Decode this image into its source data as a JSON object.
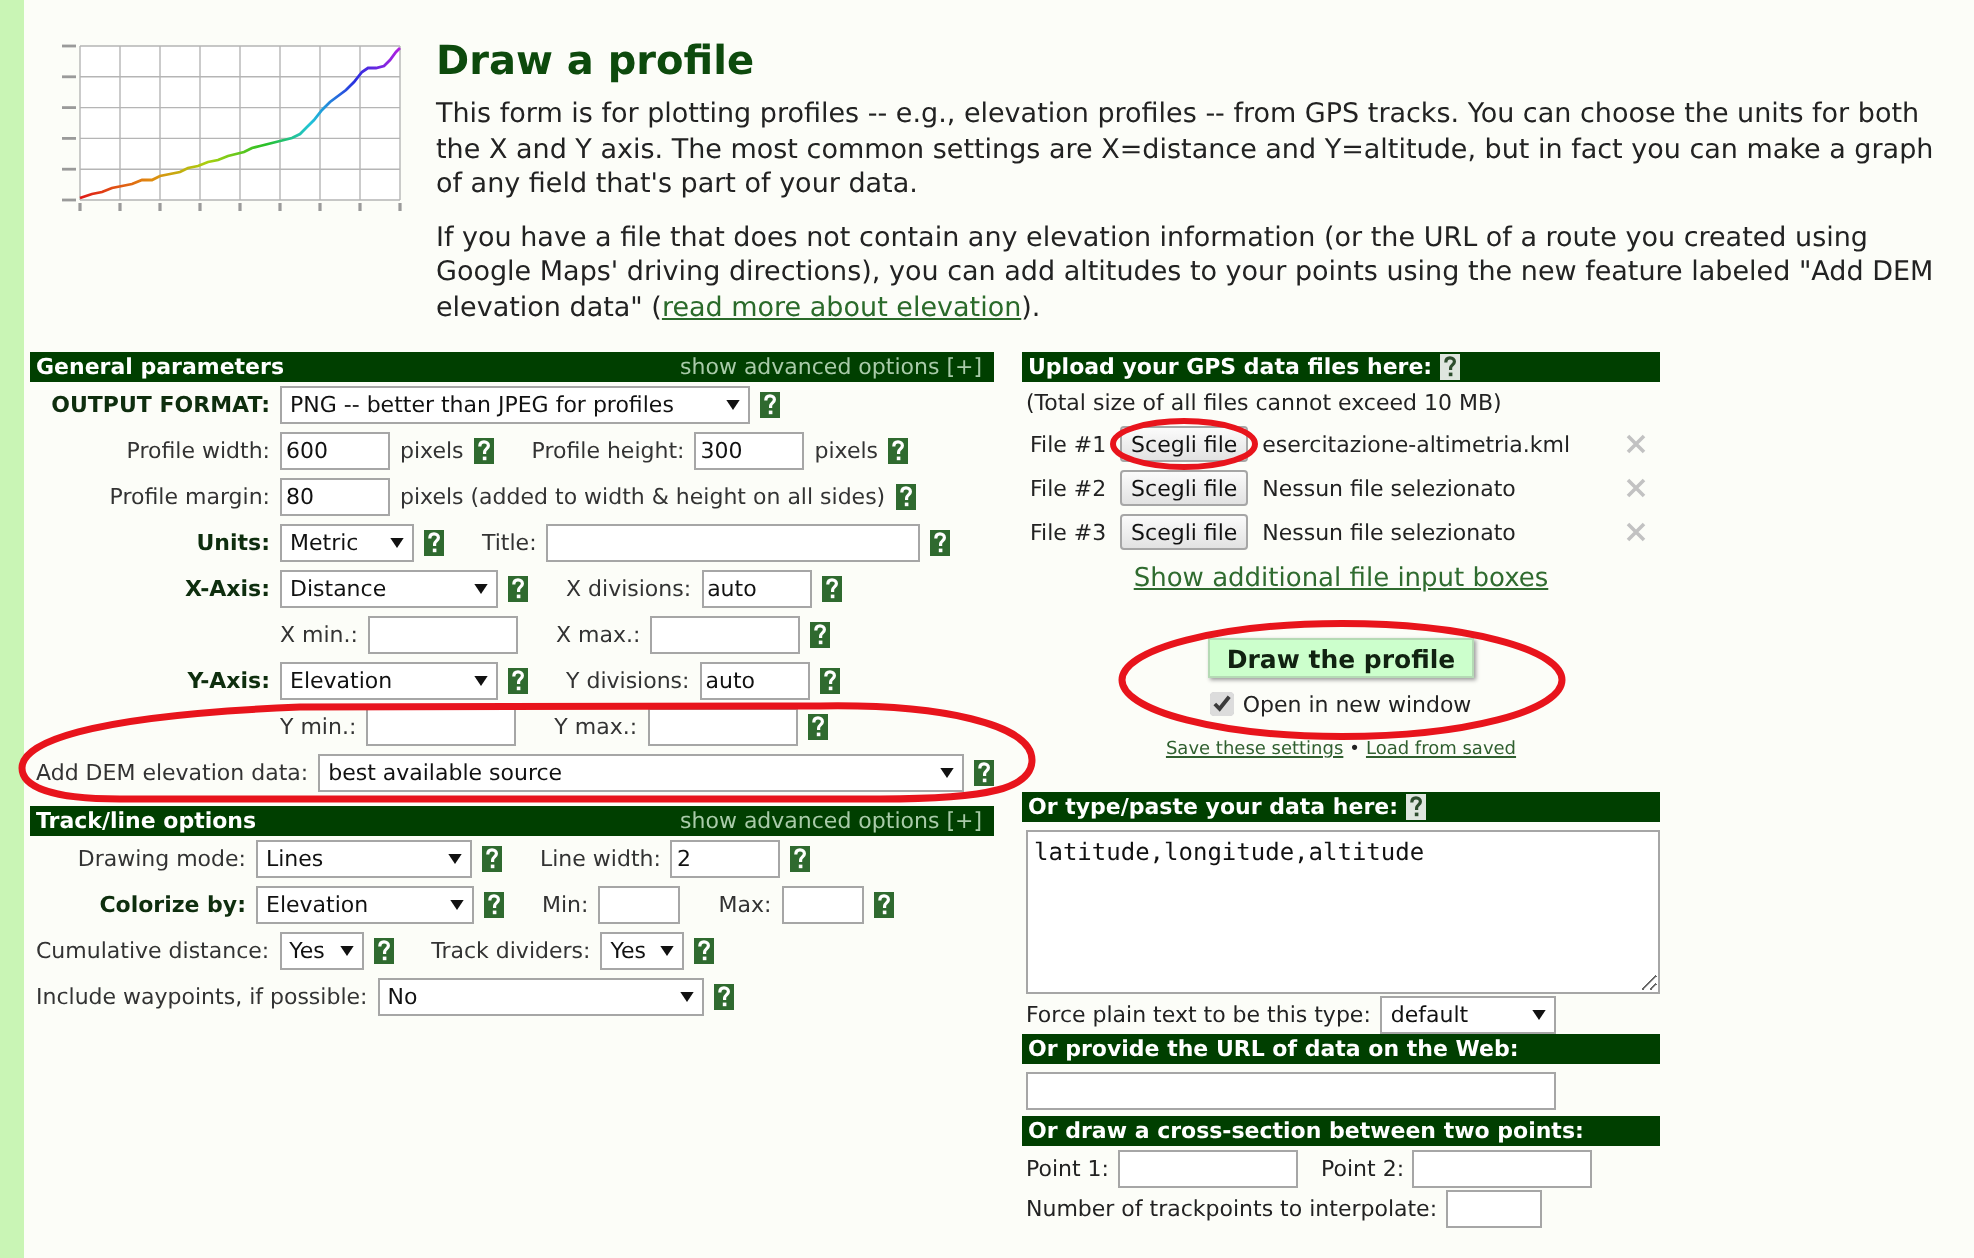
{
  "title": "Draw a profile",
  "intro": [
    {
      "text": "This form is for plotting profiles -- e.g., elevation profiles -- from GPS tracks. You can choose the units for both the X and Y axis. The most common settings are X=distance and Y=altitude, but in fact you can make a graph of any field that's part of your data."
    },
    {
      "text": "If you have a file that does not contain any elevation information (or the URL of a route you created using Google Maps' driving directions), you can add altitudes to your points using the new feature labeled \"Add DEM elevation data\" (",
      "link": "read more about elevation",
      "text_after": ")."
    }
  ],
  "general": {
    "title": "General parameters",
    "advanced": "show advanced options [+]",
    "rows": [
      {
        "kind": "aligned",
        "label": {
          "text": "OUTPUT FORMAT:",
          "bold": true
        },
        "items": [
          {
            "kind": "select",
            "value": "PNG -- better than JPEG for profiles"
          },
          {
            "kind": "help"
          }
        ]
      },
      {
        "kind": "aligned",
        "label": {
          "text": "Profile width:",
          "bold": false
        },
        "items": [
          {
            "kind": "input",
            "value": "600"
          },
          {
            "kind": "text",
            "text": "pixels"
          },
          {
            "kind": "help"
          },
          {
            "kind": "label",
            "text": "Profile height:"
          },
          {
            "kind": "input",
            "value": "300"
          },
          {
            "kind": "text",
            "text": "pixels"
          },
          {
            "kind": "help"
          }
        ]
      },
      {
        "kind": "aligned",
        "label": {
          "text": "Profile margin:",
          "bold": false
        },
        "items": [
          {
            "kind": "input",
            "value": "80"
          },
          {
            "kind": "text",
            "text": "pixels (added to width & height on all sides)"
          },
          {
            "kind": "help"
          }
        ]
      },
      {
        "kind": "aligned",
        "label": {
          "text": "Units:",
          "bold": true
        },
        "items": [
          {
            "kind": "select",
            "value": "Metric"
          },
          {
            "kind": "help"
          },
          {
            "kind": "label",
            "text": "Title:"
          },
          {
            "kind": "input"
          },
          {
            "kind": "help"
          }
        ]
      },
      {
        "kind": "aligned",
        "label": {
          "text": "X-Axis:",
          "bold": true
        },
        "items": [
          {
            "kind": "select",
            "value": "Distance"
          },
          {
            "kind": "help"
          },
          {
            "kind": "label",
            "text": "X divisions:"
          },
          {
            "kind": "input",
            "value": "auto"
          },
          {
            "kind": "help"
          }
        ]
      },
      {
        "kind": "aligned",
        "items": [
          {
            "kind": "label",
            "text": "X min.:"
          },
          {
            "kind": "input"
          },
          {
            "kind": "label",
            "text": "X max.:"
          },
          {
            "kind": "input"
          },
          {
            "kind": "help"
          }
        ]
      },
      {
        "kind": "aligned",
        "label": {
          "text": "Y-Axis:",
          "bold": true
        },
        "items": [
          {
            "kind": "select",
            "value": "Elevation"
          },
          {
            "kind": "help"
          },
          {
            "kind": "label",
            "text": "Y divisions:"
          },
          {
            "kind": "input",
            "value": "auto"
          },
          {
            "kind": "help"
          }
        ]
      },
      {
        "kind": "aligned",
        "items": [
          {
            "kind": "label",
            "text": "Y min.:"
          },
          {
            "kind": "input"
          },
          {
            "kind": "label",
            "text": "Y max.:"
          },
          {
            "kind": "input"
          },
          {
            "kind": "help"
          }
        ]
      },
      {
        "kind": "free",
        "label": {
          "text": "Add DEM elevation data:",
          "bold": false
        },
        "items": [
          {
            "kind": "select",
            "value": "best available source"
          },
          {
            "kind": "help"
          }
        ]
      }
    ]
  },
  "track": {
    "title": "Track/line options",
    "advanced": "show advanced options [+]",
    "rows": [
      {
        "kind": "aligned",
        "label": {
          "text": "Drawing mode:",
          "bold": false
        },
        "items": [
          {
            "kind": "select",
            "value": "Lines"
          },
          {
            "kind": "help"
          },
          {
            "kind": "label",
            "text": "Line width:"
          },
          {
            "kind": "input",
            "value": "2"
          },
          {
            "kind": "help"
          }
        ]
      },
      {
        "kind": "aligned",
        "label": {
          "text": "Colorize by:",
          "bold": true
        },
        "items": [
          {
            "kind": "select",
            "value": "Elevation"
          },
          {
            "kind": "help"
          },
          {
            "kind": "label",
            "text": "Min:"
          },
          {
            "kind": "input"
          },
          {
            "kind": "label",
            "text": "Max:"
          },
          {
            "kind": "input"
          },
          {
            "kind": "help"
          }
        ]
      },
      {
        "kind": "free",
        "label": {
          "text": "Cumulative distance:",
          "bold": false
        },
        "items": [
          {
            "kind": "select",
            "value": "Yes"
          },
          {
            "kind": "help"
          },
          {
            "kind": "label",
            "text": "Track dividers:"
          },
          {
            "kind": "select",
            "value": "Yes"
          },
          {
            "kind": "help"
          }
        ]
      },
      {
        "kind": "free",
        "label": {
          "text": "Include waypoints, if possible:",
          "bold": false
        },
        "items": [
          {
            "kind": "select",
            "value": "No"
          },
          {
            "kind": "help"
          }
        ]
      }
    ]
  },
  "upload": {
    "title": "Upload your GPS data files here:",
    "help": true,
    "note": "(Total size of all files cannot exceed 10 MB)",
    "files": [
      {
        "label": "File #1",
        "button": "Scegli file",
        "filename": "esercitazione-altimetria.kml"
      },
      {
        "label": "File #2",
        "button": "Scegli file",
        "filename": "Nessun file selezionato"
      },
      {
        "label": "File #3",
        "button": "Scegli file",
        "filename": "Nessun file selezionato"
      }
    ],
    "more_link": "Show additional file input boxes",
    "submit": "Draw the profile",
    "new_window": {
      "label": "Open in new window",
      "checked": true
    },
    "save_link": "Save these settings",
    "separator": "•",
    "load_link": "Load from saved"
  },
  "paste": {
    "title": "Or type/paste your data here:",
    "help": true,
    "value": "latitude,longitude,altitude",
    "type_label": "Force plain text to be this type:",
    "type_value": "default"
  },
  "url": {
    "title": "Or provide the URL of data on the Web:"
  },
  "cross_section": {
    "title": "Or draw a cross-section between two points:",
    "point1_label": "Point 1:",
    "point2_label": "Point 2:",
    "interpolate_label": "Number of trackpoints to interpolate:"
  }
}
